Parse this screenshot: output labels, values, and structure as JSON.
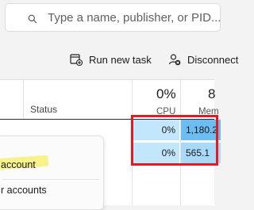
{
  "search": {
    "placeholder": "Type a name, publisher, or PID..."
  },
  "toolbar": {
    "run_new_task": "Run new task",
    "disconnect": "Disconnect"
  },
  "table": {
    "columns": {
      "status": "Status",
      "cpu_total": "0%",
      "cpu_label": "CPU",
      "memory_total": "8",
      "memory_label": "Mem"
    },
    "rows": [
      {
        "cpu": "0%",
        "memory": "1,180.2"
      },
      {
        "cpu": "0%",
        "memory": "565.1"
      }
    ]
  },
  "context_menu": {
    "items": [
      "account",
      "r accounts"
    ]
  },
  "colors": {
    "cpu_cell": "#c2e6fb",
    "mem_cell_high": "#6bbdf2",
    "mem_cell_low": "#a9d9f8",
    "annotation_box": "#e01b24",
    "marker": "#f6f064"
  }
}
